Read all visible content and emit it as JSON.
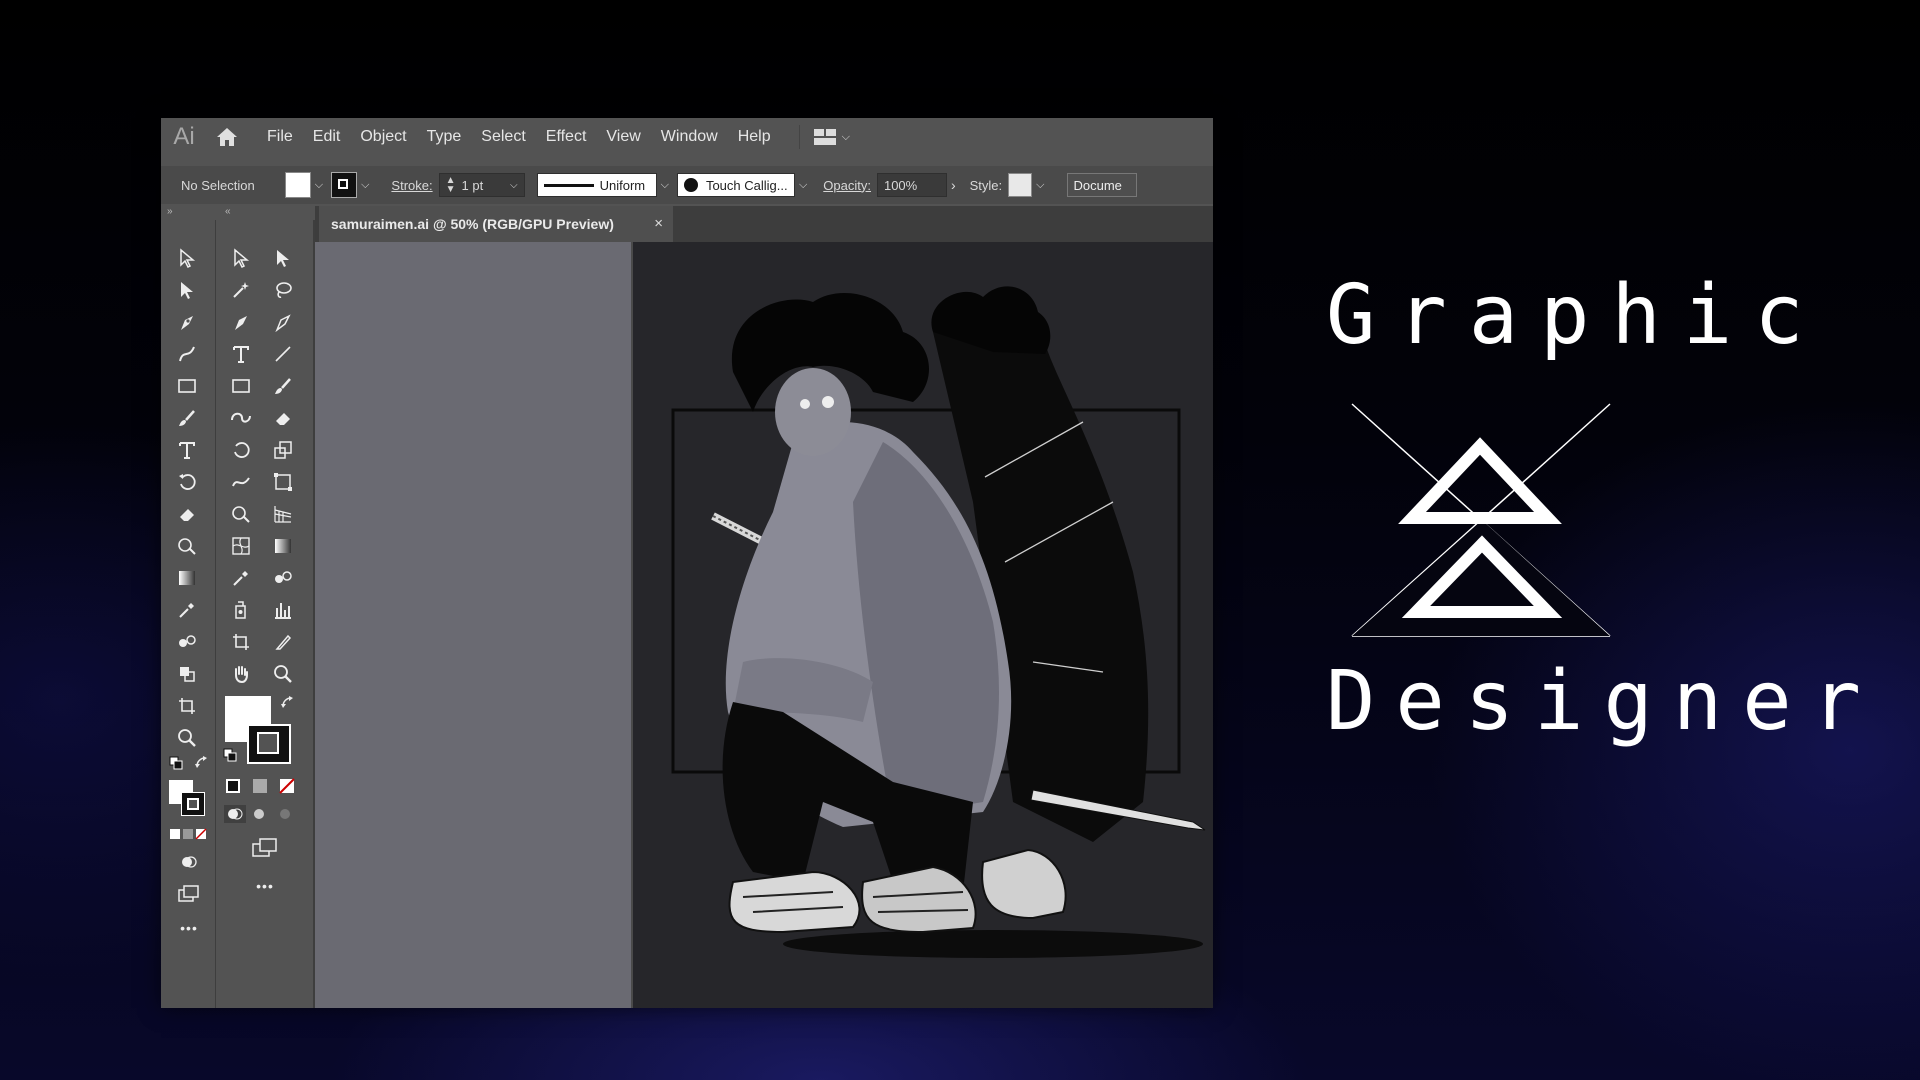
{
  "app": {
    "logo": "Ai",
    "menu": [
      "File",
      "Edit",
      "Object",
      "Type",
      "Select",
      "Effect",
      "View",
      "Window",
      "Help"
    ]
  },
  "control_bar": {
    "selection": "No Selection",
    "stroke_label": "Stroke:",
    "stroke_weight": "1 pt",
    "profile": "Uniform",
    "brush": "Touch Callig...",
    "opacity_label": "Opacity:",
    "opacity_value": "100%",
    "style_label": "Style:",
    "document_button": "Docume",
    "fill_color": "#ffffff",
    "stroke_color": "#111111"
  },
  "document": {
    "tab_title": "samuraimen.ai @ 50% (RGB/GPU Preview)",
    "close_glyph": "×"
  },
  "panels": {
    "collapse_left": "»",
    "collapse_right": "«",
    "more_tools": "•••"
  },
  "hero": {
    "line1": "Graphic",
    "line2": "Designer"
  },
  "colors": {
    "accent_blue": "#1a1a80",
    "ui_dark": "#535353",
    "canvas": "#26262a"
  }
}
